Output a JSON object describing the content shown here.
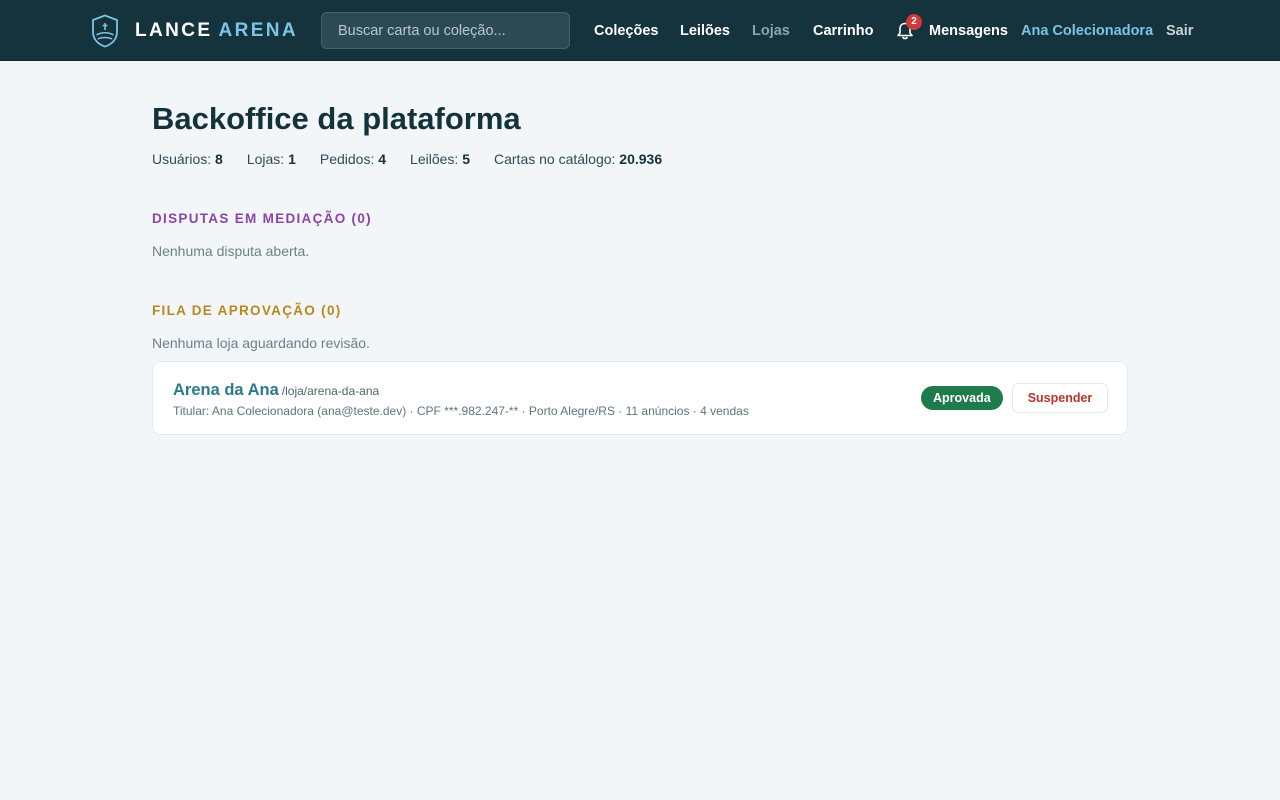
{
  "header": {
    "logo_primary": "LANCE",
    "logo_accent": "ARENA",
    "search_placeholder": "Buscar carta ou coleção...",
    "nav": {
      "collections": "Coleções",
      "auctions": "Leilões",
      "stores": "Lojas",
      "cart": "Carrinho",
      "messages": "Mensagens",
      "user": "Ana Colecionadora",
      "logout": "Sair"
    },
    "notifications_count": "2"
  },
  "page": {
    "title": "Backoffice da plataforma",
    "stats": [
      {
        "label": "Usuários:",
        "value": "8"
      },
      {
        "label": "Lojas:",
        "value": "1"
      },
      {
        "label": "Pedidos:",
        "value": "4"
      },
      {
        "label": "Leilões:",
        "value": "5"
      },
      {
        "label": "Cartas no catálogo:",
        "value": "20.936"
      }
    ]
  },
  "disputes": {
    "heading": "DISPUTAS EM MEDIAÇÃO (0)",
    "empty": "Nenhuma disputa aberta."
  },
  "approval": {
    "heading": "FILA DE APROVAÇÃO (0)",
    "empty": "Nenhuma loja aguardando revisão."
  },
  "store": {
    "name": "Arena da Ana",
    "slug": "/loja/arena-da-ana",
    "meta": "Titular: Ana Colecionadora (ana@teste.dev) · CPF ***.982.247-** · Porto Alegre/RS · 11 anúncios · 4 vendas",
    "status": "Aprovada",
    "action": "Suspender"
  },
  "colors": {
    "topbar": "#14333d",
    "accent": "#7cc4e4",
    "approved": "#1f7a4c",
    "danger": "#b8342e",
    "disputes_heading": "#8b44a8",
    "approval_heading": "#b7891a"
  },
  "icons": [
    "shield-logo-icon",
    "bell-icon"
  ]
}
